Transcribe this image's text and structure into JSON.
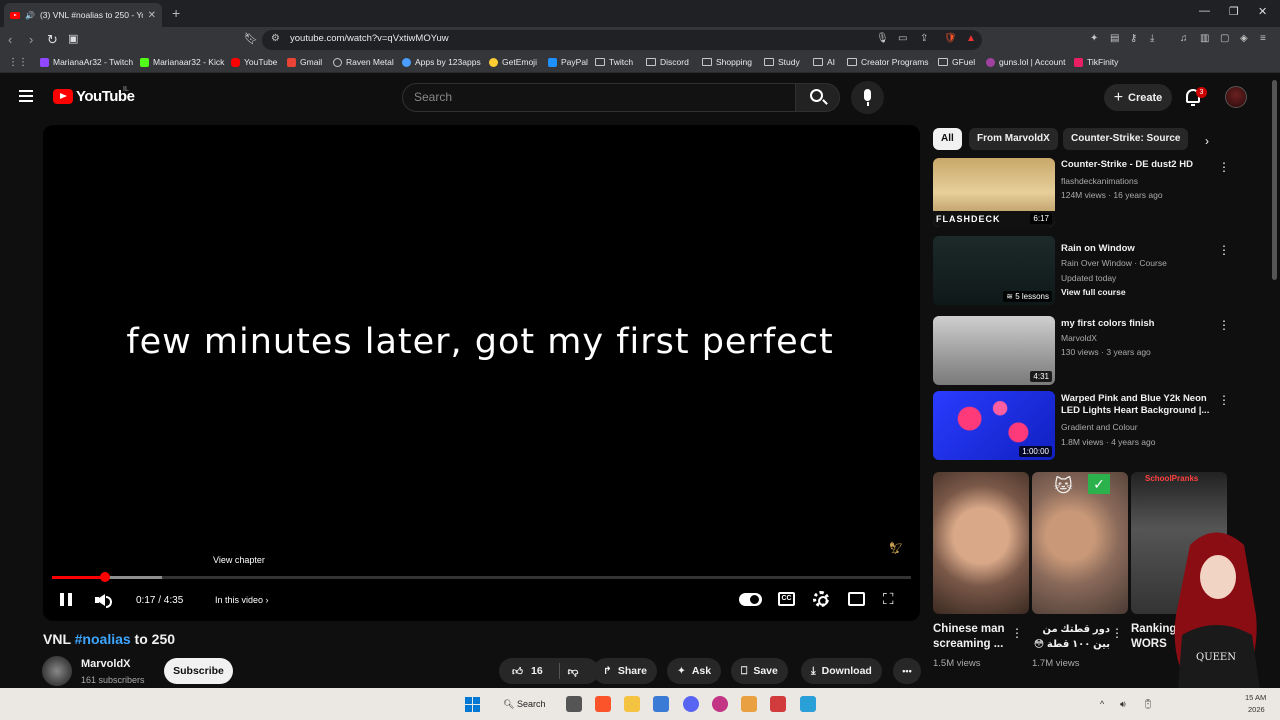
{
  "browser": {
    "tab_title": "(3) VNL #noalias to 250 - You",
    "tab_close": "✕",
    "new_tab": "+",
    "url": "youtube.com/watch?v=qVxtiwMOYuw",
    "window_controls": [
      "—",
      "❐",
      "✕"
    ]
  },
  "bookmarks": [
    {
      "label": "MarianaAr32 - Twitch",
      "icon": "twitch",
      "color": "#9146ff"
    },
    {
      "label": "Marianaar32 - Kick",
      "icon": "kick",
      "color": "#53fc18"
    },
    {
      "label": "YouTube",
      "icon": "youtube",
      "color": "#ff0000"
    },
    {
      "label": "Gmail",
      "icon": "gmail",
      "color": "#ea4335"
    },
    {
      "label": "Raven Metal",
      "icon": "globe",
      "color": "#c4c7c5"
    },
    {
      "label": "Apps by 123apps",
      "icon": "apps",
      "color": "#4a9eff"
    },
    {
      "label": "GetEmoji",
      "icon": "emoji",
      "color": "#ffcc33"
    },
    {
      "label": "PayPal",
      "icon": "paypal",
      "color": "#1e90ff"
    },
    {
      "label": "Twitch",
      "icon": "folder",
      "color": "#c4c7c5"
    },
    {
      "label": "Discord",
      "icon": "folder",
      "color": "#c4c7c5"
    },
    {
      "label": "Shopping",
      "icon": "folder",
      "color": "#c4c7c5"
    },
    {
      "label": "Study",
      "icon": "folder",
      "color": "#c4c7c5"
    },
    {
      "label": "AI",
      "icon": "folder",
      "color": "#c4c7c5"
    },
    {
      "label": "Creator Programs",
      "icon": "folder",
      "color": "#c4c7c5"
    },
    {
      "label": "GFuel",
      "icon": "folder",
      "color": "#c4c7c5"
    },
    {
      "label": "guns.lol | Account",
      "icon": "guns",
      "color": "#a040a0"
    },
    {
      "label": "TikFinity",
      "icon": "tikfinity",
      "color": "#e91e63"
    }
  ],
  "header": {
    "logo_text": "YouTube",
    "country_code": "IL",
    "search_placeholder": "Search",
    "create_label": "Create",
    "notification_count": "3"
  },
  "player": {
    "caption": "few minutes later, got my first perfect",
    "view_chapter": "View chapter",
    "time": "0:17 / 4:35",
    "in_this_video": "In this video",
    "progress_fraction": 0.062,
    "cc_label": "CC"
  },
  "video": {
    "title_prefix": "VNL ",
    "title_tag": "#noalias",
    "title_suffix": " to 250",
    "channel": "MarvoldX",
    "subscribers": "161 subscribers",
    "subscribe_label": "Subscribe",
    "likes": "16",
    "share_label": "Share",
    "ask_label": "Ask",
    "save_label": "Save",
    "download_label": "Download",
    "more": "•••"
  },
  "chips": [
    "All",
    "From MarvoldX",
    "Counter-Strike: Source"
  ],
  "recommended": [
    {
      "title": "Counter-Strike - DE dust2 HD",
      "meta1": "flashdeckanimations",
      "meta2": "124M views · 16 years ago",
      "duration": "6:17",
      "thumb_label": "FLASHDECK"
    },
    {
      "title": "Rain on Window",
      "meta1": "Rain Over Window · Course",
      "meta2": "Updated today",
      "meta3": "View full course",
      "duration": "5 lessons"
    },
    {
      "title": "my first colors finish",
      "meta1": "MarvoldX",
      "meta2": "130 views · 3 years ago",
      "duration": "4:31"
    },
    {
      "title": "Warped Pink and Blue Y2k Neon LED Lights Heart Background |...",
      "meta1": "Gradient and Colour",
      "meta2": "1.8M views · 4 years ago",
      "duration": "1:00:00"
    }
  ],
  "shorts": [
    {
      "title": "Chinese man screaming ...",
      "views": "1.5M views"
    },
    {
      "title": "دور قطتك من بين ١٠٠ قطة 😳",
      "views": "1.7M views"
    },
    {
      "title": "Ranking WORS",
      "views": "",
      "banner": "SchoolPranks"
    }
  ],
  "taskbar": {
    "search_label": "Search",
    "time": "15 AM",
    "year": "2026"
  },
  "colors": {
    "accent_red": "#ff0000",
    "link_blue": "#3ea6ff",
    "bg": "#0f0f0f"
  }
}
